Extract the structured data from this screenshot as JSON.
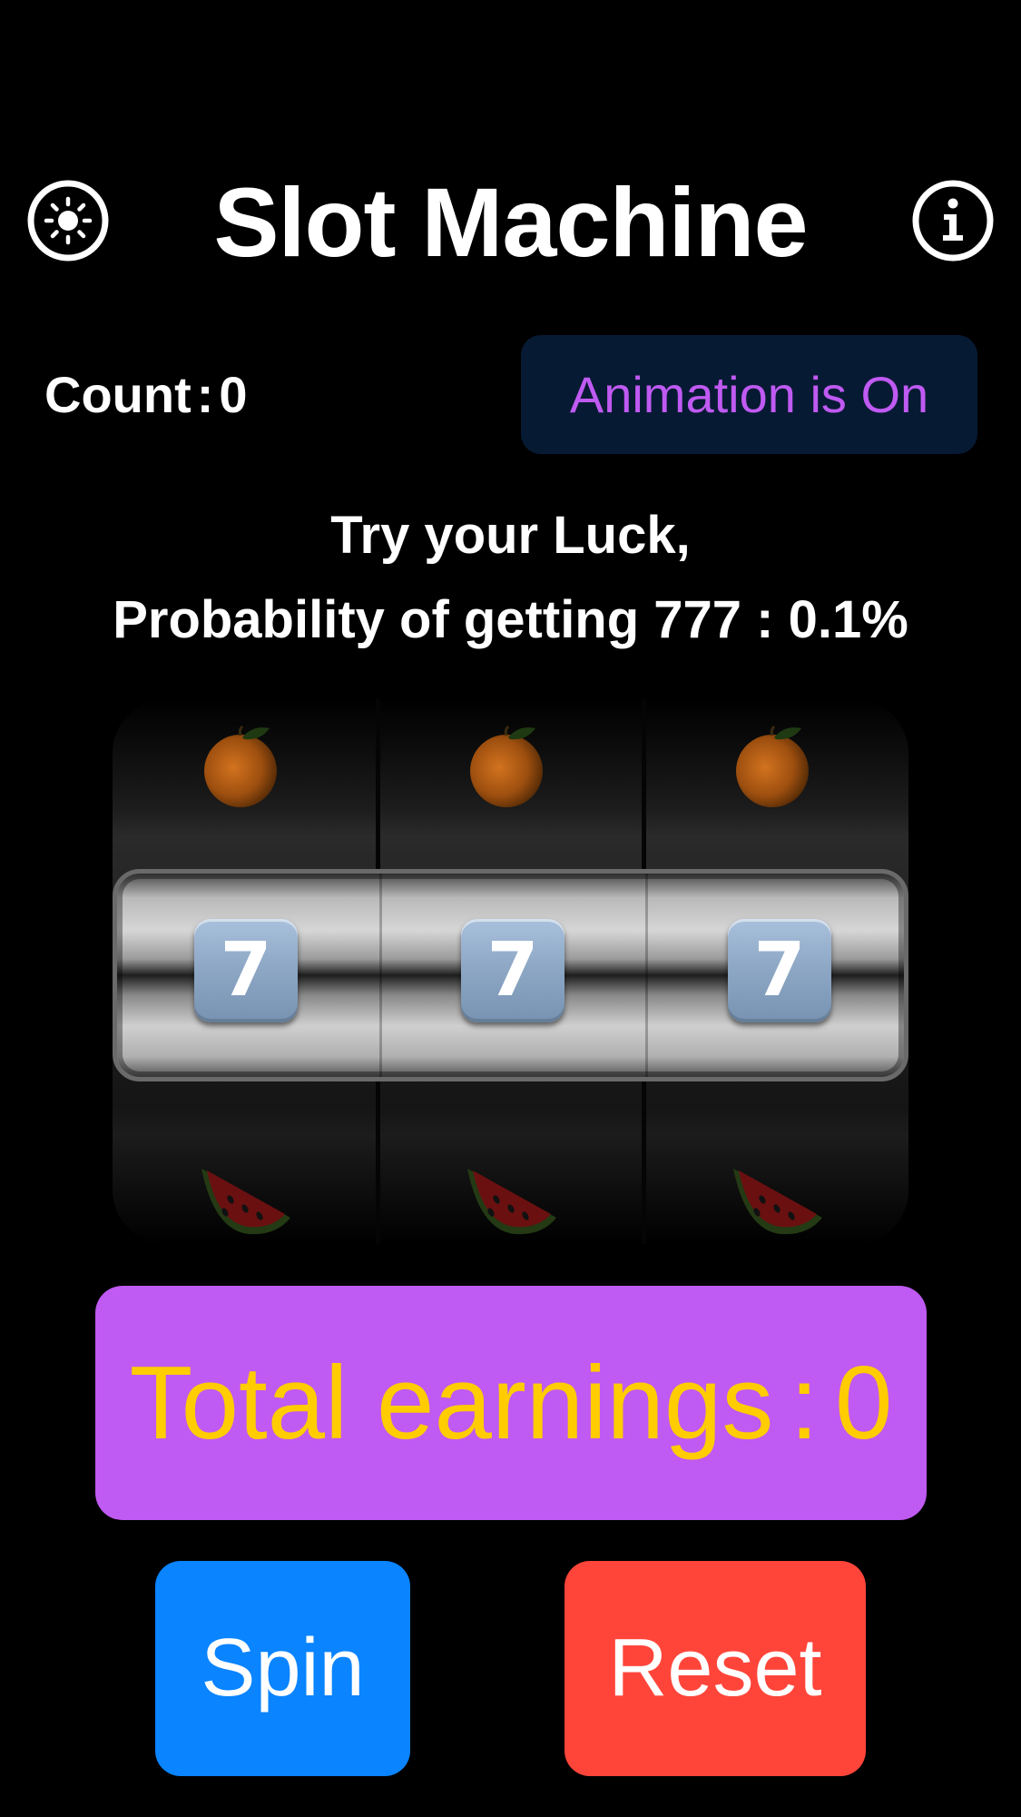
{
  "header": {
    "title": "Slot Machine",
    "theme_icon": "sun-icon",
    "info_icon": "info-icon"
  },
  "status": {
    "count_label": "Count",
    "count_sep": ":",
    "count_value": "0",
    "animation_label": "Animation is On"
  },
  "messages": {
    "line1": "Try your Luck,",
    "line2": "Probability of getting 777 : 0.1%"
  },
  "reels": {
    "top_symbol": "orange",
    "center_symbol": "7",
    "bottom_symbol": "watermelon"
  },
  "earnings": {
    "label": "Total earnings",
    "sep": ":",
    "value": "0"
  },
  "buttons": {
    "spin": "Spin",
    "reset": "Reset"
  },
  "colors": {
    "background": "#000000",
    "animation_button_bg": "#071a33",
    "accent_purple": "#bf5af2",
    "earnings_text": "#ffcc00",
    "spin_button": "#0a84ff",
    "reset_button": "#ff453a"
  }
}
